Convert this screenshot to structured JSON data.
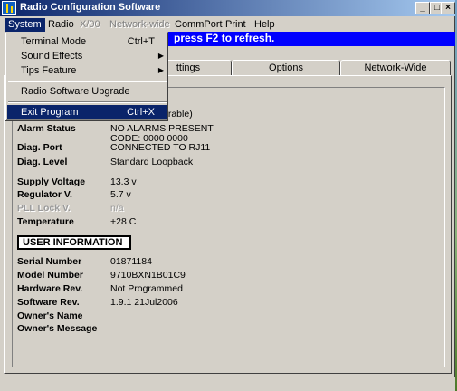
{
  "window": {
    "title": "Radio Configuration Software",
    "controls": [
      "_",
      "□",
      "×"
    ]
  },
  "menubar": {
    "items": [
      {
        "label": "System",
        "state": "active"
      },
      {
        "label": "Radio",
        "state": "normal"
      },
      {
        "label": "X/90",
        "state": "disabled"
      },
      {
        "label": "Network-wide",
        "state": "disabled"
      },
      {
        "label": "CommPort",
        "state": "normal"
      },
      {
        "label": "Print",
        "state": "normal"
      },
      {
        "label": "Help",
        "state": "normal"
      }
    ]
  },
  "status_strip": "press F2 to refresh.",
  "system_menu": {
    "items": [
      {
        "label": "Terminal Mode",
        "shortcut": "Ctrl+T"
      },
      {
        "label": "Sound Effects",
        "submenu": true
      },
      {
        "label": "Tips Feature",
        "submenu": true
      },
      {
        "label": "Radio Software Upgrade"
      },
      {
        "label": "Exit Program",
        "shortcut": "Ctrl+X",
        "highlighted": true
      }
    ]
  },
  "tabs": [
    "ttings",
    "Options",
    "Network-Wide"
  ],
  "details": {
    "partial_line": "erable)",
    "alarm_status_label": "Alarm Status",
    "alarm_status_value": "NO ALARMS PRESENT",
    "alarm_code": "CODE: 0000 0000",
    "diag_port_label": "Diag. Port",
    "diag_port_value": "CONNECTED TO RJ11",
    "diag_level_label": "Diag. Level",
    "diag_level_value": "Standard Loopback",
    "supply_voltage_label": "Supply Voltage",
    "supply_voltage_value": "13.3 v",
    "regulator_label": "Regulator V.",
    "regulator_value": "5.7 v",
    "pll_lock_label": "PLL Lock V.",
    "pll_lock_value": "n/a",
    "temperature_label": "Temperature",
    "temperature_value": "+28 C"
  },
  "user_info": {
    "heading": "USER INFORMATION",
    "serial_label": "Serial Number",
    "serial_value": "01871184",
    "model_label": "Model Number",
    "model_value": "9710BXN1B01C9",
    "hardware_label": "Hardware Rev.",
    "hardware_value": "Not Programmed",
    "software_label": "Software  Rev.",
    "software_value": "1.9.1  21Jul2006",
    "owner_name_label": "Owner's Name",
    "owner_message_label": "Owner's Message"
  },
  "colors": {
    "titlebar_start": "#0a246a",
    "titlebar_end": "#a6caf0",
    "status_strip": "#0000ff",
    "menu_highlight": "#0a246a",
    "face": "#d4d0c8"
  }
}
